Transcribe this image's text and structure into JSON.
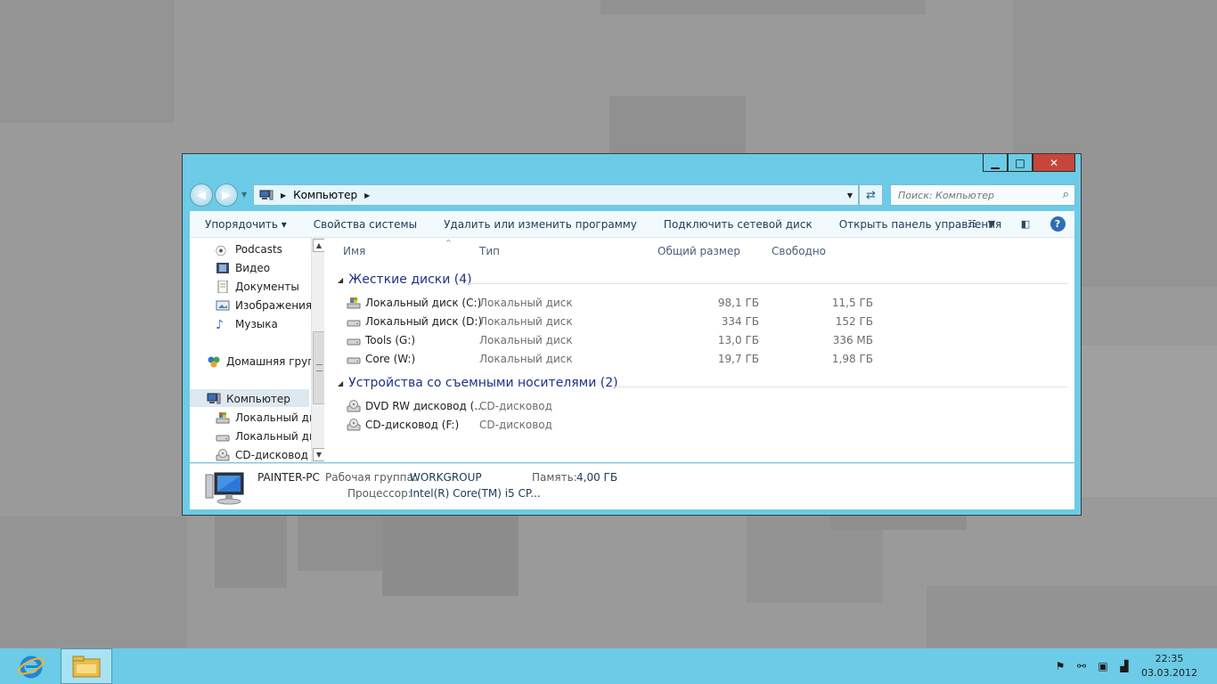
{
  "window": {
    "minimize": "▁",
    "maximize": "□",
    "close": "✕"
  },
  "address": {
    "location": "Компьютер",
    "search_placeholder": "Поиск: Компьютер"
  },
  "toolbar": {
    "organize": "Упорядочить ▾",
    "system_properties": "Свойства системы",
    "uninstall": "Удалить или изменить программу",
    "map_drive": "Подключить сетевой диск",
    "control_panel": "Открыть панель управления"
  },
  "nav_pane": {
    "items": [
      {
        "label": "Podcasts",
        "icon": "podcast-icon"
      },
      {
        "label": "Видео",
        "icon": "video-icon"
      },
      {
        "label": "Документы",
        "icon": "documents-icon"
      },
      {
        "label": "Изображения",
        "icon": "images-icon"
      },
      {
        "label": "Музыка",
        "icon": "music-icon"
      },
      {
        "label": "Домашняя групп",
        "icon": "homegroup-icon"
      },
      {
        "label": "Компьютер",
        "icon": "computer-icon"
      },
      {
        "label": "Локальный дис",
        "icon": "windows-drive-icon"
      },
      {
        "label": "Локальный дис",
        "icon": "drive-icon"
      },
      {
        "label": "CD-дисковод (F",
        "icon": "cd-drive-icon"
      }
    ]
  },
  "columns": {
    "name": "Имя",
    "type": "Тип",
    "total": "Общий размер",
    "free": "Свободно"
  },
  "groups": {
    "hard_drives": "Жесткие диски (4)",
    "removable": "Устройства со съемными носителями (2)"
  },
  "drives": [
    {
      "name": "Локальный диск (C:)",
      "type": "Локальный диск",
      "total": "98,1 ГБ",
      "free": "11,5 ГБ"
    },
    {
      "name": "Локальный диск (D:)",
      "type": "Локальный диск",
      "total": "334 ГБ",
      "free": "152 ГБ"
    },
    {
      "name": "Tools (G:)",
      "type": "Локальный диск",
      "total": "13,0 ГБ",
      "free": "336 МБ"
    },
    {
      "name": "Core (W:)",
      "type": "Локальный диск",
      "total": "19,7 ГБ",
      "free": "1,98 ГБ"
    }
  ],
  "removable": [
    {
      "name": "DVD RW дисковод (...",
      "type": "CD-дисковод"
    },
    {
      "name": "CD-дисковод (F:)",
      "type": "CD-дисковод"
    }
  ],
  "details": {
    "computer_name": "PAINTER-PC",
    "workgroup_label": "Рабочая группа:",
    "workgroup_value": "WORKGROUP",
    "memory_label": "Память:",
    "memory_value": "4,00 ГБ",
    "cpu_label": "Процессор:",
    "cpu_value": "Intel(R) Core(TM) i5 CP..."
  },
  "taskbar": {
    "time": "22:35",
    "date": "03.03.2012"
  }
}
